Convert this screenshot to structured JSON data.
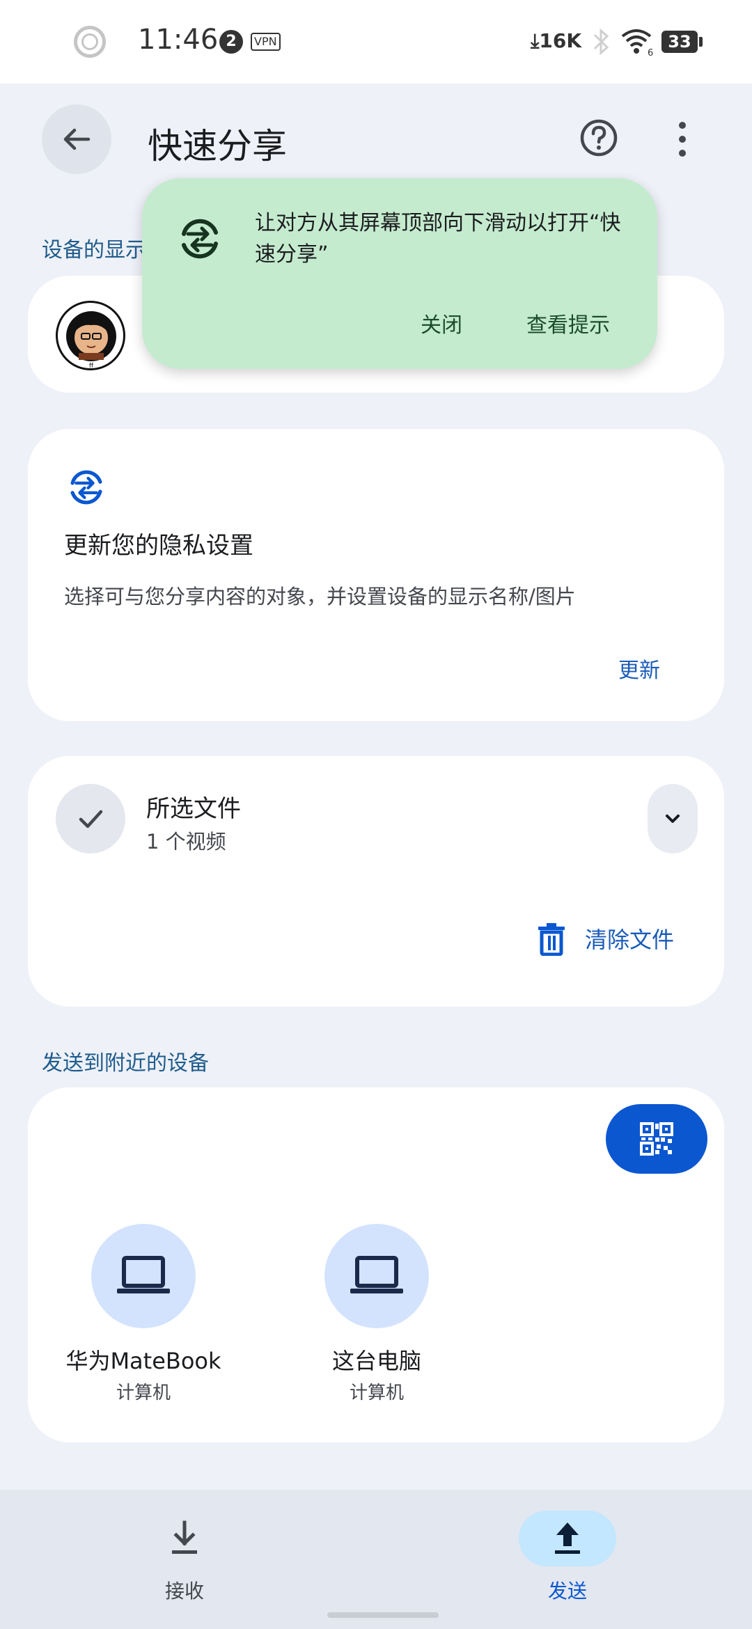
{
  "status_bar": {
    "time": "11:46",
    "notification_count": "2",
    "vpn_label": "VPN",
    "net_speed": "16K",
    "wifi_label": "6",
    "battery": "33"
  },
  "header": {
    "title": "快速分享",
    "icons": {
      "back": "arrow-left-icon",
      "help": "help-circle-icon",
      "more": "more-vertical-icon"
    }
  },
  "device_visibility": {
    "label": "设备的显示",
    "name_fragment": "ff"
  },
  "tip_popup": {
    "message": "让对方从其屏幕顶部向下滑动以打开“快速分享”",
    "close_label": "关闭",
    "tips_label": "查看提示",
    "icon": "quick-share-icon"
  },
  "privacy_card": {
    "title": "更新您的隐私设置",
    "description": "选择可与您分享内容的对象，并设置设备的显示名称/图片",
    "update_label": "更新",
    "icon": "quick-share-icon"
  },
  "files_card": {
    "title": "所选文件",
    "subtitle": "1 个视频",
    "clear_label": "清除文件"
  },
  "nearby": {
    "label": "发送到附近的设备",
    "devices": [
      {
        "name": "华为MateBook",
        "type": "计算机"
      },
      {
        "name": "这台电脑",
        "type": "计算机"
      }
    ]
  },
  "bottom_nav": {
    "items": [
      {
        "label": "接收",
        "icon": "download-icon",
        "active": false
      },
      {
        "label": "发送",
        "icon": "upload-icon",
        "active": true
      }
    ]
  },
  "colors": {
    "accent": "#0b57d0",
    "popup_bg": "#c5ebcf",
    "section_label": "#1f5c8c",
    "page_bg": "#eef1f7"
  }
}
